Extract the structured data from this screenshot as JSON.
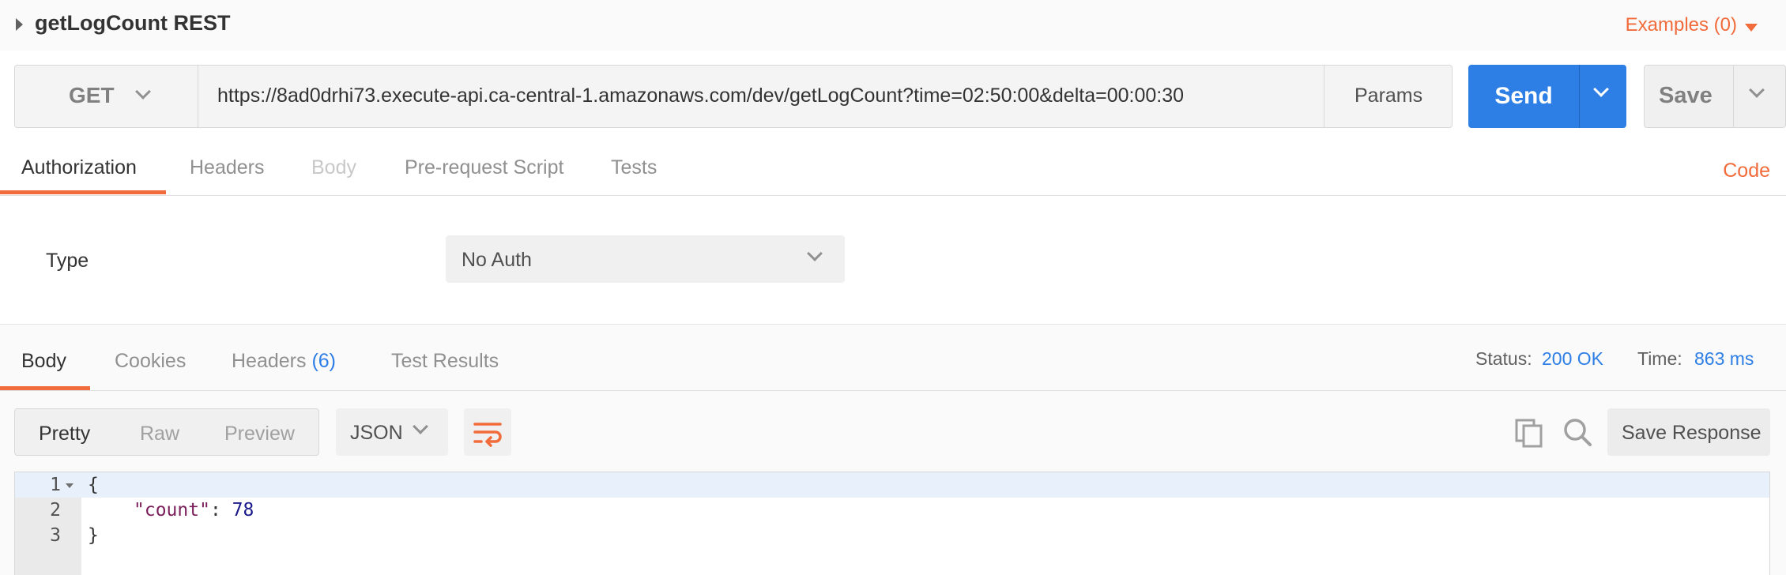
{
  "request": {
    "name": "getLogCount REST",
    "examples_label": "Examples (0)",
    "method": "GET",
    "url": "https://8ad0drhi73.execute-api.ca-central-1.amazonaws.com/dev/getLogCount?time=02:50:00&delta=00:00:30",
    "params_label": "Params",
    "send_label": "Send",
    "save_label": "Save"
  },
  "request_tabs": {
    "authorization": "Authorization",
    "headers": "Headers",
    "body": "Body",
    "pre_request": "Pre-request Script",
    "tests": "Tests",
    "code_link": "Code"
  },
  "auth": {
    "type_label": "Type",
    "type_value": "No Auth"
  },
  "response": {
    "tabs": {
      "body": "Body",
      "cookies": "Cookies",
      "headers": "Headers",
      "headers_count": "(6)",
      "test_results": "Test Results"
    },
    "status_label": "Status:",
    "status_value": "200 OK",
    "time_label": "Time:",
    "time_value": "863 ms",
    "formats": [
      "Pretty",
      "Raw",
      "Preview"
    ],
    "language": "JSON",
    "save_response_label": "Save Response",
    "lines": [
      {
        "num": "1",
        "text": "{"
      },
      {
        "num": "2",
        "key": "\"count\"",
        "sep": ": ",
        "value": "78"
      },
      {
        "num": "3",
        "text": "}"
      }
    ]
  },
  "colors": {
    "accent_orange": "#f26b3a",
    "send_blue": "#2d7ee5"
  }
}
